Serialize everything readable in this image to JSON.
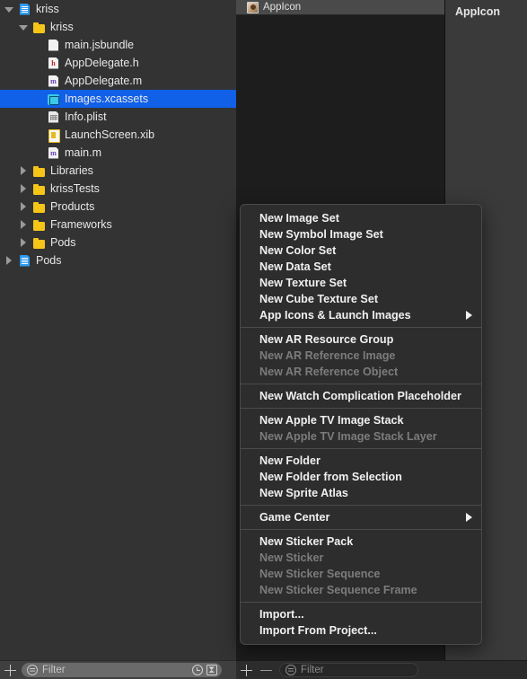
{
  "navigator": {
    "items": [
      {
        "label": "kriss",
        "indent": 0,
        "disclosure": "open",
        "icon": "project-file-icon",
        "icon_class": "proj",
        "letter": "",
        "selected": false
      },
      {
        "label": "kriss",
        "indent": 1,
        "disclosure": "open",
        "icon": "folder-icon",
        "icon_class": "folder",
        "letter": "",
        "selected": false
      },
      {
        "label": "main.jsbundle",
        "indent": 2,
        "disclosure": "none",
        "icon": "file-icon",
        "icon_class": "doc doc-plain",
        "letter": "",
        "selected": false
      },
      {
        "label": "AppDelegate.h",
        "indent": 2,
        "disclosure": "none",
        "icon": "header-file-icon",
        "icon_class": "doc doc-h",
        "letter": "h",
        "selected": false
      },
      {
        "label": "AppDelegate.m",
        "indent": 2,
        "disclosure": "none",
        "icon": "objc-file-icon",
        "icon_class": "doc doc-m",
        "letter": "m",
        "selected": false
      },
      {
        "label": "Images.xcassets",
        "indent": 2,
        "disclosure": "none",
        "icon": "asset-catalog-icon",
        "icon_class": "assets",
        "letter": "",
        "selected": true
      },
      {
        "label": "Info.plist",
        "indent": 2,
        "disclosure": "none",
        "icon": "plist-file-icon",
        "icon_class": "doc doc-plist",
        "letter": "",
        "selected": false
      },
      {
        "label": "LaunchScreen.xib",
        "indent": 2,
        "disclosure": "none",
        "icon": "xib-file-icon",
        "icon_class": "xib",
        "letter": "",
        "selected": false
      },
      {
        "label": "main.m",
        "indent": 2,
        "disclosure": "none",
        "icon": "objc-file-icon",
        "icon_class": "doc doc-m",
        "letter": "m",
        "selected": false
      },
      {
        "label": "Libraries",
        "indent": 1,
        "disclosure": "closed",
        "icon": "folder-icon",
        "icon_class": "folder",
        "letter": "",
        "selected": false
      },
      {
        "label": "krissTests",
        "indent": 1,
        "disclosure": "closed",
        "icon": "folder-icon",
        "icon_class": "folder",
        "letter": "",
        "selected": false
      },
      {
        "label": "Products",
        "indent": 1,
        "disclosure": "closed",
        "icon": "folder-icon",
        "icon_class": "folder",
        "letter": "",
        "selected": false
      },
      {
        "label": "Frameworks",
        "indent": 1,
        "disclosure": "closed",
        "icon": "folder-icon",
        "icon_class": "folder",
        "letter": "",
        "selected": false
      },
      {
        "label": "Pods",
        "indent": 1,
        "disclosure": "closed",
        "icon": "folder-icon",
        "icon_class": "folder",
        "letter": "",
        "selected": false
      },
      {
        "label": "Pods",
        "indent": 0,
        "disclosure": "closed",
        "icon": "project-file-icon",
        "icon_class": "proj",
        "letter": "",
        "selected": false
      }
    ]
  },
  "asset_list": {
    "rows": [
      {
        "label": "AppIcon",
        "icon": "app-icon-thumbnail"
      }
    ]
  },
  "detail": {
    "title": "AppIcon"
  },
  "context_menu": {
    "groups": [
      {
        "items": [
          {
            "label": "New Image Set",
            "disabled": false,
            "submenu": false
          },
          {
            "label": "New Symbol Image Set",
            "disabled": false,
            "submenu": false
          },
          {
            "label": "New Color Set",
            "disabled": false,
            "submenu": false
          },
          {
            "label": "New Data Set",
            "disabled": false,
            "submenu": false
          },
          {
            "label": "New Texture Set",
            "disabled": false,
            "submenu": false
          },
          {
            "label": "New Cube Texture Set",
            "disabled": false,
            "submenu": false
          },
          {
            "label": "App Icons & Launch Images",
            "disabled": false,
            "submenu": true
          }
        ]
      },
      {
        "items": [
          {
            "label": "New AR Resource Group",
            "disabled": false,
            "submenu": false
          },
          {
            "label": "New AR Reference Image",
            "disabled": true,
            "submenu": false
          },
          {
            "label": "New AR Reference Object",
            "disabled": true,
            "submenu": false
          }
        ]
      },
      {
        "items": [
          {
            "label": "New Watch Complication Placeholder",
            "disabled": false,
            "submenu": false
          }
        ]
      },
      {
        "items": [
          {
            "label": "New Apple TV Image Stack",
            "disabled": false,
            "submenu": false
          },
          {
            "label": "New Apple TV Image Stack Layer",
            "disabled": true,
            "submenu": false
          }
        ]
      },
      {
        "items": [
          {
            "label": "New Folder",
            "disabled": false,
            "submenu": false
          },
          {
            "label": "New Folder from Selection",
            "disabled": false,
            "submenu": false
          },
          {
            "label": "New Sprite Atlas",
            "disabled": false,
            "submenu": false
          }
        ]
      },
      {
        "items": [
          {
            "label": "Game Center",
            "disabled": false,
            "submenu": true
          }
        ]
      },
      {
        "items": [
          {
            "label": "New Sticker Pack",
            "disabled": false,
            "submenu": false
          },
          {
            "label": "New Sticker",
            "disabled": true,
            "submenu": false
          },
          {
            "label": "New Sticker Sequence",
            "disabled": true,
            "submenu": false
          },
          {
            "label": "New Sticker Sequence Frame",
            "disabled": true,
            "submenu": false
          }
        ]
      },
      {
        "items": [
          {
            "label": "Import...",
            "disabled": false,
            "submenu": false
          },
          {
            "label": "Import From Project...",
            "disabled": false,
            "submenu": false
          }
        ]
      }
    ]
  },
  "bottom_bar": {
    "navigator_filter_placeholder": "Filter",
    "navigator_filter_value": "",
    "asset_filter_placeholder": "Filter",
    "asset_filter_value": "",
    "add_label": "+",
    "remove_label": "−"
  },
  "colors": {
    "selection_blue": "#1060e8",
    "navigator_bg": "#333333",
    "menu_bg": "#2d2d2d",
    "folder_yellow": "#f5c518"
  }
}
